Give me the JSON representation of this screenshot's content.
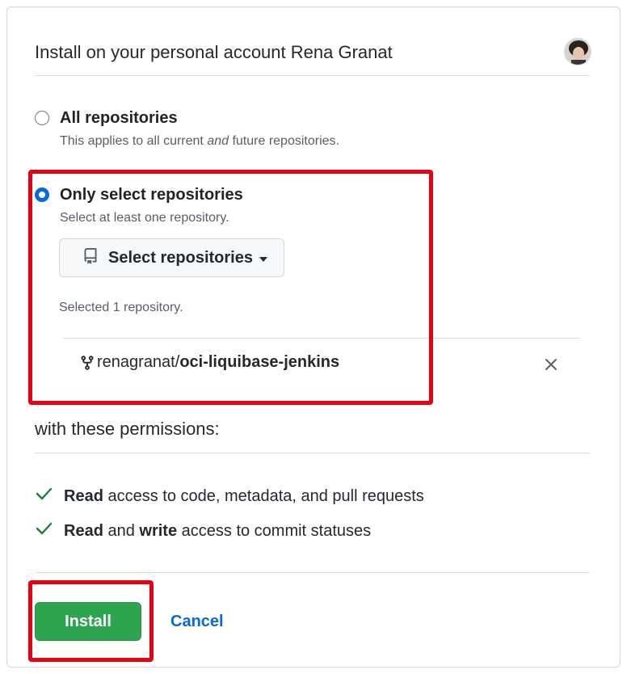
{
  "header": {
    "title": "Install on your personal account Rena Granat",
    "avatar_icon": "user-avatar"
  },
  "repo_access": {
    "all": {
      "label": "All repositories",
      "note_before": "This applies to all current ",
      "note_emph": "and",
      "note_after": " future repositories.",
      "checked": false
    },
    "select": {
      "label": "Only select repositories",
      "note": "Select at least one repository.",
      "checked": true,
      "button_label": "Select repositories",
      "button_icon": "repo-icon",
      "selected_count_text": "Selected 1 repository.",
      "repositories": [
        {
          "owner": "renagranat",
          "name": "oci-liquibase-jenkins",
          "icon": "repo-forked-icon"
        }
      ]
    }
  },
  "permissions": {
    "heading": "with these permissions:",
    "items": [
      {
        "parts": [
          {
            "text": "Read",
            "bold": true
          },
          {
            "text": " access to code, metadata, and pull requests",
            "bold": false
          }
        ]
      },
      {
        "parts": [
          {
            "text": "Read",
            "bold": true
          },
          {
            "text": " and ",
            "bold": false
          },
          {
            "text": "write",
            "bold": true
          },
          {
            "text": " access to commit statuses",
            "bold": false
          }
        ]
      }
    ]
  },
  "actions": {
    "install_label": "Install",
    "cancel_label": "Cancel"
  },
  "colors": {
    "accent_blue": "#0969da",
    "install_green": "#2da44e",
    "check_green": "#1a7f37",
    "highlight_red": "#e50012"
  }
}
